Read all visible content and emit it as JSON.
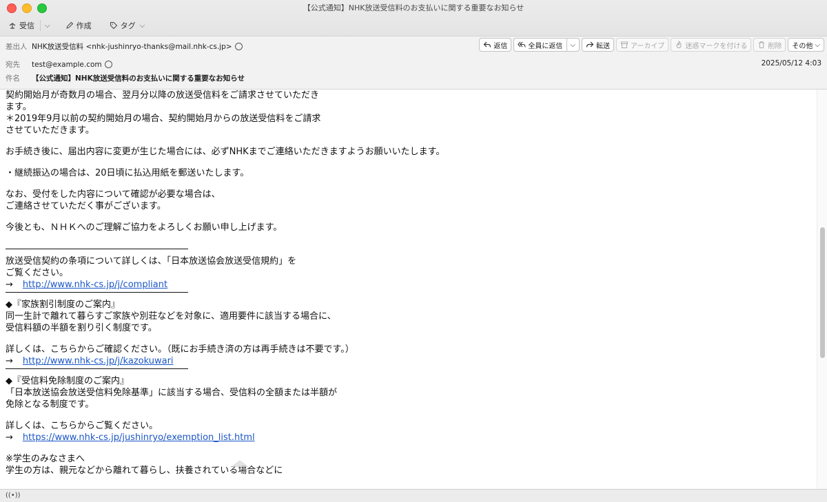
{
  "window": {
    "title": "【公式通知】NHK放送受信料のお支払いに関する重要なお知らせ"
  },
  "toolbar": {
    "receive_label": "受信",
    "compose_label": "作成",
    "tag_label": "タグ"
  },
  "header": {
    "from_label": "差出人",
    "from_value": "NHK放送受信料 <nhk-jushinryo-thanks@mail.nhk-cs.jp>",
    "to_label": "宛先",
    "to_value": "test@example.com",
    "subject_label": "件名",
    "subject_value": "【公式通知】NHK放送受信料のお支払いに関する重要なお知らせ",
    "date": "2025/05/12 4:03"
  },
  "actions": {
    "reply": "返信",
    "reply_all": "全員に返信",
    "forward": "転送",
    "archive": "アーカイブ",
    "junk": "迷惑マークを付ける",
    "delete": "削除",
    "other": "その他"
  },
  "body": {
    "lines": [
      "契約開始月が奇数月の場合、翌月分以降の放送受信料をご請求させていただき",
      "ます。",
      "＊2019年9月以前の契約開始月の場合、契約開始月からの放送受信料をご請求",
      "させていただきます。",
      "お手続き後に、届出内容に変更が生じた場合には、必ずNHKまでご連絡いただきますようお願いいたします。",
      "・継続振込の場合は、20日頃に払込用紙を郵送いたします。",
      "なお、受付をした内容について確認が必要な場合は、",
      "ご連絡させていただく事がございます。",
      "今後とも、ＮＨＫへのご理解ご協力をよろしくお願い申し上げます。",
      "放送受信契約の条項について詳しくは、「日本放送協会放送受信規約」を",
      "ご覧ください。",
      "◆『家族割引制度のご案内』",
      "同一生計で離れて暮らすご家族や別荘などを対象に、適用要件に該当する場合に、",
      "受信料額の半額を割り引く制度です。",
      "詳しくは、こちらからご確認ください。（既にお手続き済の方は再手続きは不要です。）",
      "◆『受信料免除制度のご案内』",
      "「日本放送協会放送受信料免除基準」に該当する場合、受信料の全額または半額が",
      "免除となる制度です。",
      "詳しくは、こちらからご覧ください。",
      "※学生のみなさまへ",
      "学生の方は、親元などから離れて暮らし、扶養されている場合などに"
    ],
    "arrow": "→",
    "link1": "http://www.nhk-cs.jp/j/compliant",
    "link2": "http://www.nhk-cs.jp/j/kazokuwari",
    "link3": "https://www.nhk-cs.jp/jushinryo/exemption_list.html"
  },
  "colors": {
    "link": "#1a56c6",
    "header_bg": "#f2f2f2"
  }
}
